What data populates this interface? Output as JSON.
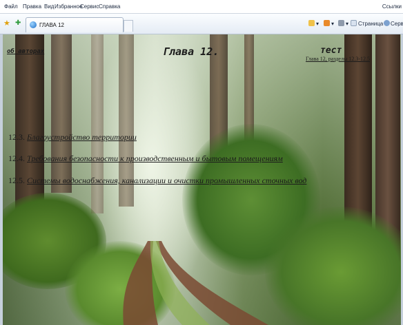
{
  "menu": {
    "items": [
      "Файл",
      "Правка",
      "Вид",
      "Избранное",
      "Сервис",
      "Справка"
    ],
    "right_label": "Ссылки"
  },
  "tab": {
    "title": "ГЛАВА 12"
  },
  "commands": {
    "page": "Страница",
    "tools": "Сервис"
  },
  "page": {
    "authors_link": "об авторах",
    "chapter_title": "Глава 12.",
    "test_title": "тест",
    "test_link": "Глава 12, разделы 12.3-12.5",
    "sections": [
      {
        "number": "12.3.",
        "title": "Благоустройство территории"
      },
      {
        "number": "12.4.",
        "title": "Требования безопасности к производственным и бытовым помещениям"
      },
      {
        "number": "12.5.",
        "title": "Системы водоснабжения, канализации и очистки промышленных сточных вод"
      }
    ]
  },
  "colors": {
    "toolbar_bg": "#e4ebf4",
    "text": "#1b1b1b"
  }
}
